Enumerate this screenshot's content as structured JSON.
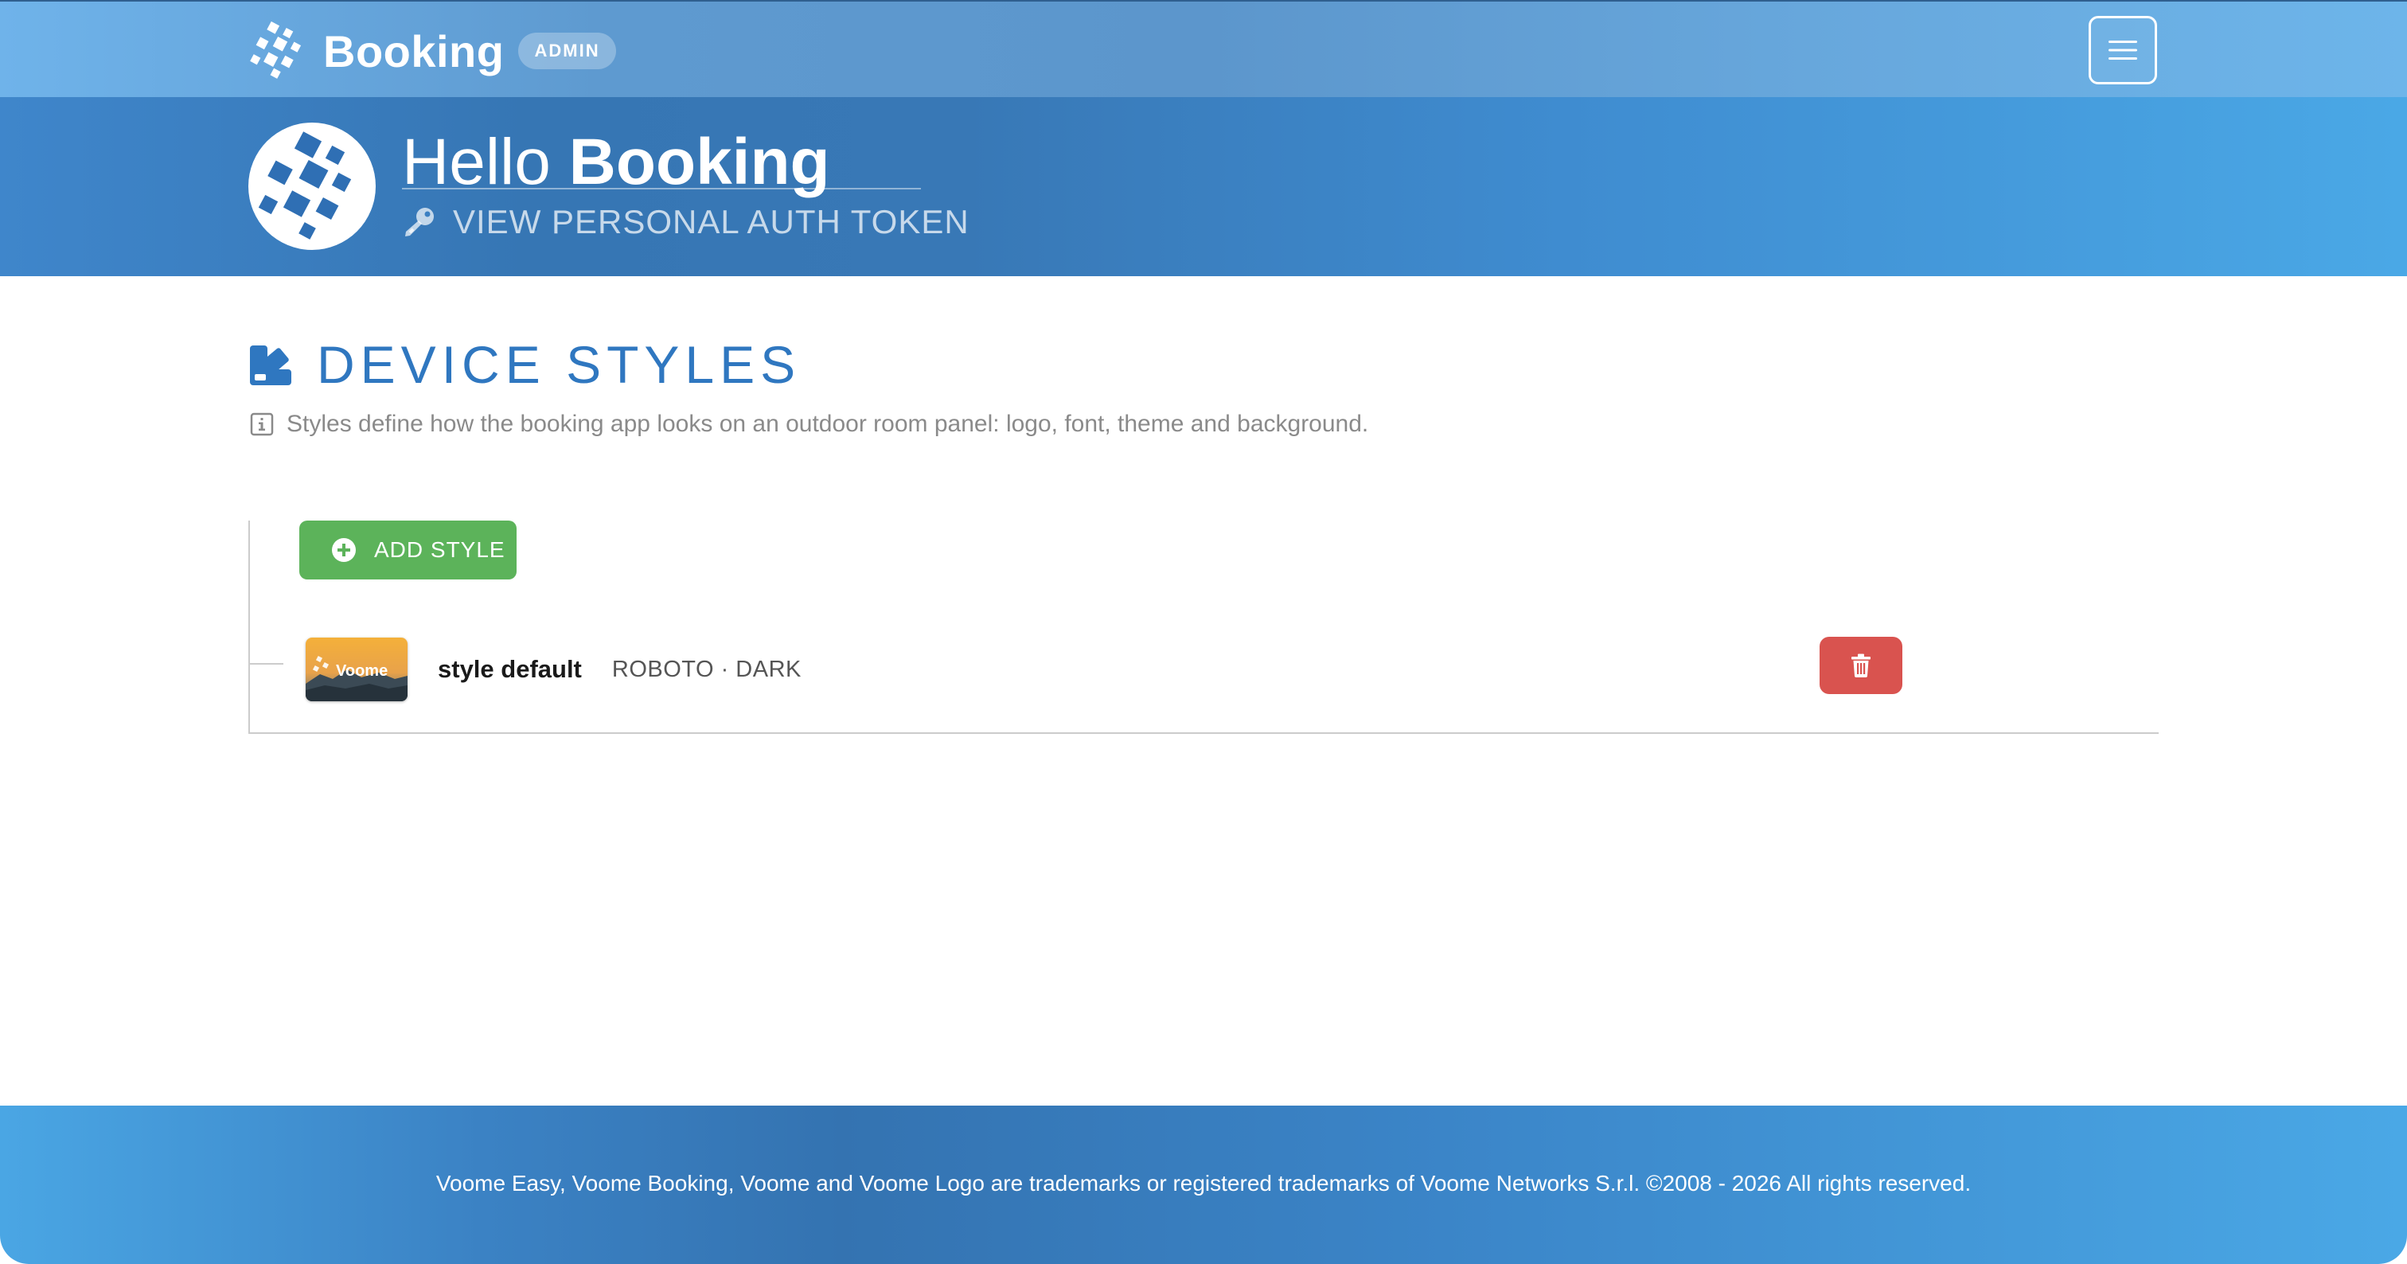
{
  "header": {
    "brand_name": "Booking",
    "badge": "ADMIN",
    "menu_icon": "hamburger-menu-icon"
  },
  "hero": {
    "greeting": "Hello",
    "user_name": "Booking",
    "auth_token_link": "VIEW PERSONAL AUTH TOKEN",
    "auth_icon": "key-icon"
  },
  "main": {
    "title": "DEVICE STYLES",
    "title_icon": "swatch-book-icon",
    "info_icon": "info-icon",
    "info_text": "Styles define how the booking app looks on an outdoor room panel: logo, font, theme and background.",
    "add_button_label": "ADD STYLE",
    "styles": [
      {
        "name": "style default",
        "meta": "ROBOTO · DARK",
        "thumbnail_text": "Voome",
        "delete_icon": "trash-icon"
      }
    ]
  },
  "footer": {
    "text": "Voome Easy, Voome Booking, Voome and Voome Logo are trademarks or registered trademarks of Voome Networks S.r.l. ©2008 - 2026 All rights reserved."
  },
  "colors": {
    "primary_blue": "#2f77c0",
    "success_green": "#5cb35a",
    "danger_red": "#d9534f",
    "muted_text": "#8a8a8a"
  }
}
